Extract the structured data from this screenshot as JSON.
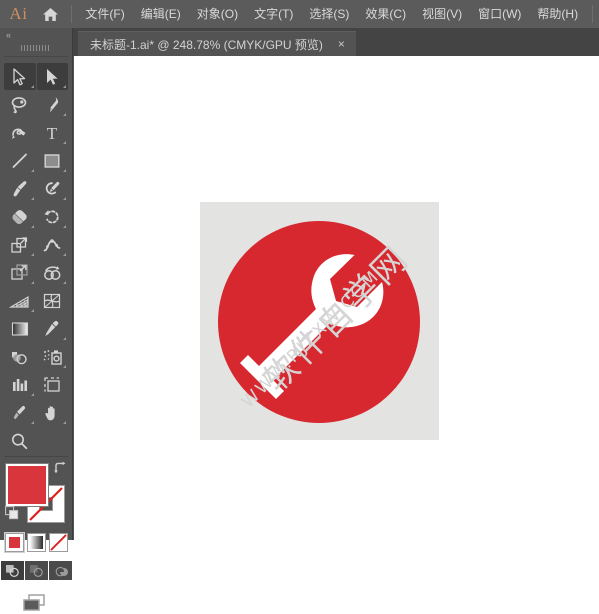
{
  "app": {
    "logo_text": "Ai",
    "home_icon": "home-icon"
  },
  "menubar": {
    "items": [
      {
        "label": "文件(F)",
        "name": "menu-file"
      },
      {
        "label": "编辑(E)",
        "name": "menu-edit"
      },
      {
        "label": "对象(O)",
        "name": "menu-object"
      },
      {
        "label": "文字(T)",
        "name": "menu-type"
      },
      {
        "label": "选择(S)",
        "name": "menu-select"
      },
      {
        "label": "效果(C)",
        "name": "menu-effect"
      },
      {
        "label": "视图(V)",
        "name": "menu-view"
      },
      {
        "label": "窗口(W)",
        "name": "menu-window"
      },
      {
        "label": "帮助(H)",
        "name": "menu-help"
      }
    ]
  },
  "tabbar": {
    "tab_title": "未标题-1.ai* @ 248.78% (CMYK/GPU 预览)",
    "close_label": "×"
  },
  "toolbar": {
    "collapse_label": "«",
    "tools": [
      {
        "name": "selection-tool",
        "label": "选择工具",
        "selected": true,
        "corner": true
      },
      {
        "name": "direct-selection-tool",
        "label": "直接选择工具",
        "selected": true,
        "corner": true
      },
      {
        "name": "lasso-tool",
        "label": "套索工具",
        "selected": false,
        "corner": false
      },
      {
        "name": "pen-tool",
        "label": "钢笔工具",
        "selected": false,
        "corner": true
      },
      {
        "name": "curvature-tool",
        "label": "曲率工具",
        "selected": false,
        "corner": false
      },
      {
        "name": "type-tool",
        "label": "文字工具",
        "selected": false,
        "corner": true
      },
      {
        "name": "line-segment-tool",
        "label": "直线段工具",
        "selected": false,
        "corner": true
      },
      {
        "name": "rectangle-tool",
        "label": "矩形工具",
        "selected": false,
        "corner": true
      },
      {
        "name": "paintbrush-tool",
        "label": "画笔工具",
        "selected": false,
        "corner": true
      },
      {
        "name": "shaper-tool",
        "label": "Shaper 工具",
        "selected": false,
        "corner": true
      },
      {
        "name": "eraser-tool",
        "label": "橡皮擦工具",
        "selected": false,
        "corner": true
      },
      {
        "name": "rotate-tool",
        "label": "旋转工具",
        "selected": false,
        "corner": true
      },
      {
        "name": "scale-tool",
        "label": "缩放工具",
        "selected": false,
        "corner": true
      },
      {
        "name": "width-tool",
        "label": "宽度工具",
        "selected": false,
        "corner": true
      },
      {
        "name": "free-transform-tool",
        "label": "自由变换工具",
        "selected": false,
        "corner": true
      },
      {
        "name": "shape-builder-tool",
        "label": "形状生成器工具",
        "selected": false,
        "corner": true
      },
      {
        "name": "perspective-grid-tool",
        "label": "透视网格工具",
        "selected": false,
        "corner": true
      },
      {
        "name": "mesh-tool",
        "label": "网格工具",
        "selected": false,
        "corner": false
      },
      {
        "name": "gradient-tool",
        "label": "渐变工具",
        "selected": false,
        "corner": false
      },
      {
        "name": "eyedropper-tool",
        "label": "吸管工具",
        "selected": false,
        "corner": true
      },
      {
        "name": "blend-tool",
        "label": "混合工具",
        "selected": false,
        "corner": false
      },
      {
        "name": "symbol-sprayer-tool",
        "label": "符号喷枪工具",
        "selected": false,
        "corner": true
      },
      {
        "name": "column-graph-tool",
        "label": "柱形图工具",
        "selected": false,
        "corner": true
      },
      {
        "name": "artboard-tool",
        "label": "画板工具",
        "selected": false,
        "corner": false
      },
      {
        "name": "slice-tool",
        "label": "切片工具",
        "selected": false,
        "corner": true
      },
      {
        "name": "hand-tool",
        "label": "抓手工具",
        "selected": false,
        "corner": true
      },
      {
        "name": "zoom-tool",
        "label": "缩放显示工具",
        "selected": false,
        "corner": false
      }
    ],
    "fill_color": "#d8353c",
    "stroke_color": "none",
    "mode_buttons": [
      {
        "name": "fill-color-mode",
        "label": "颜色",
        "active": true
      },
      {
        "name": "fill-gradient-mode",
        "label": "渐变",
        "active": false
      },
      {
        "name": "fill-none-mode",
        "label": "无",
        "active": false
      }
    ],
    "draw_modes": [
      {
        "name": "draw-normal-mode",
        "label": "正常绘图",
        "active": true
      },
      {
        "name": "draw-behind-mode",
        "label": "背面绘图",
        "active": false
      },
      {
        "name": "draw-inside-mode",
        "label": "内部绘图",
        "active": false
      }
    ],
    "screen_mode_label": "更改屏幕模式"
  },
  "canvas": {
    "artboard_background": "#e3e3e2",
    "circle_color": "#d8282f",
    "wrench_color": "#ffffff",
    "zoom_level": "248.78%",
    "watermark_cn": "软件自学网",
    "watermark_en": "WWW.RJZXW.COM",
    "watermark_color": "#d5d5d5"
  }
}
